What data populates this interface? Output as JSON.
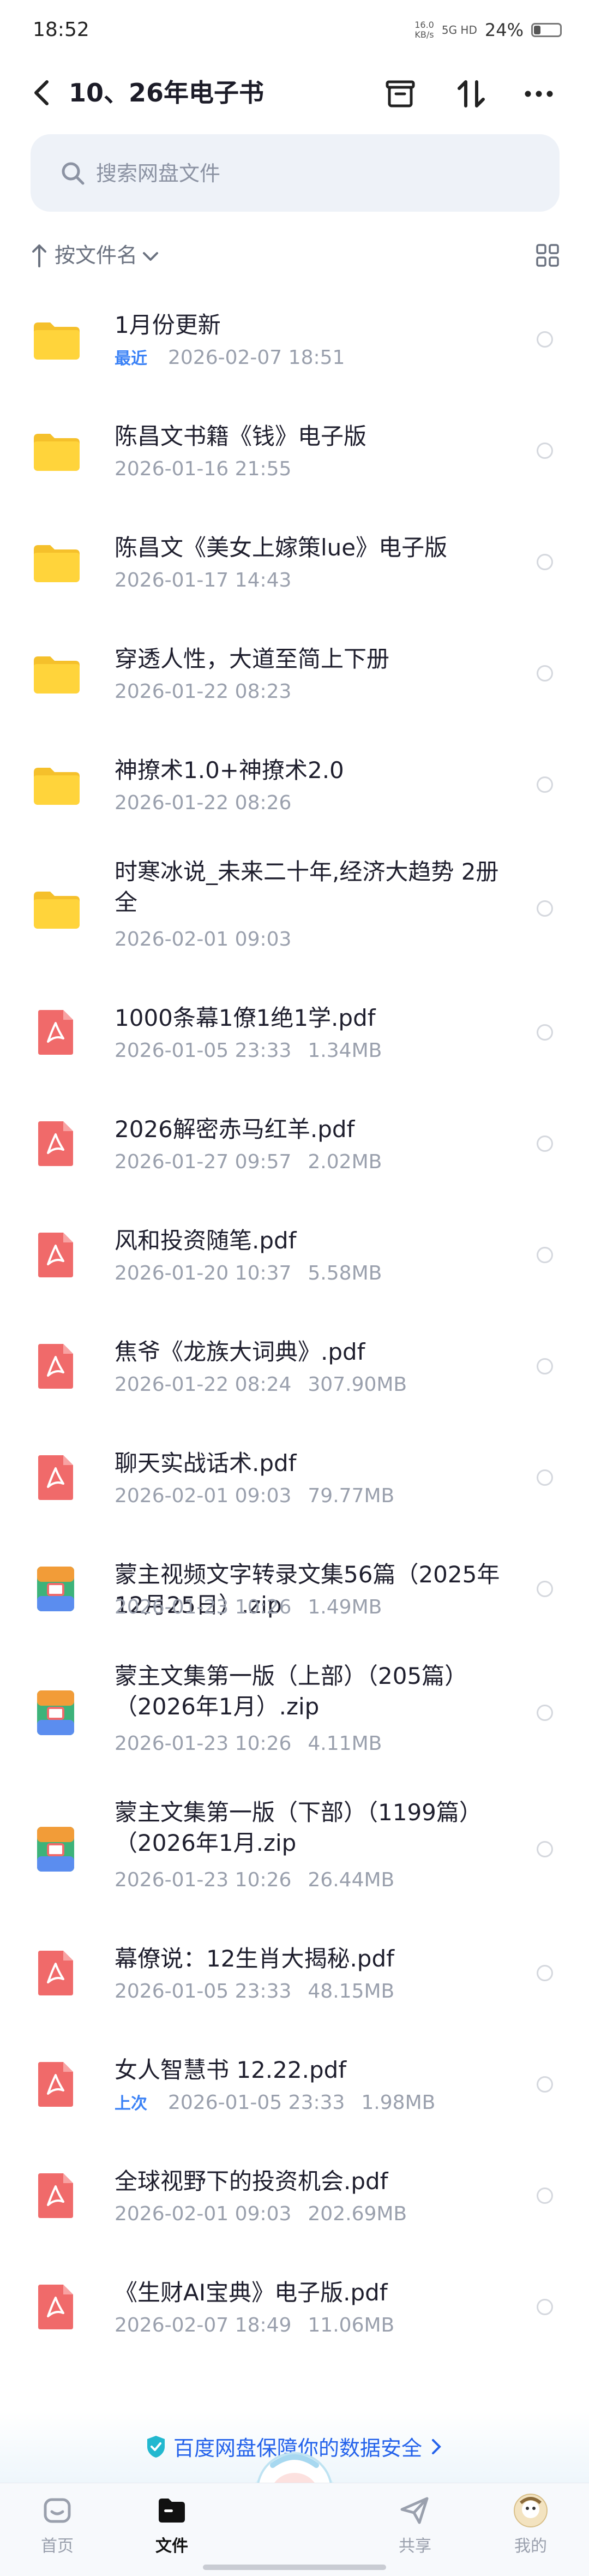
{
  "status_bar": {
    "time": "18:52",
    "net_speed_top": "16.0",
    "net_speed_bottom": "KB/s",
    "network": "5G HD",
    "battery": "24%"
  },
  "header": {
    "title": "10、26年电子书"
  },
  "search": {
    "placeholder": "搜索网盘文件"
  },
  "sort": {
    "label": "按文件名"
  },
  "files": [
    {
      "type": "folder",
      "name": "1月份更新",
      "date": "2026-02-07  18:51",
      "size": "",
      "tag": "最近"
    },
    {
      "type": "folder",
      "name": "陈昌文书籍《钱》电子版",
      "date": "2026-01-16  21:55",
      "size": "",
      "tag": ""
    },
    {
      "type": "folder",
      "name": "陈昌文《美女上嫁策lue》电子版",
      "date": "2026-01-17  14:43",
      "size": "",
      "tag": ""
    },
    {
      "type": "folder",
      "name": "穿透人性，大道至简上下册",
      "date": "2026-01-22  08:23",
      "size": "",
      "tag": ""
    },
    {
      "type": "folder",
      "name": "神撩术1.0+神撩术2.0",
      "date": "2026-01-22  08:26",
      "size": "",
      "tag": ""
    },
    {
      "type": "folder",
      "name": "时寒冰说_未来二十年,经济大趋势 2册全",
      "date": "2026-02-01  09:03",
      "size": "",
      "tag": ""
    },
    {
      "type": "pdf",
      "name": "1000条幕1僚1绝1学.pdf",
      "date": "2026-01-05  23:33",
      "size": "1.34MB",
      "tag": ""
    },
    {
      "type": "pdf",
      "name": "2026解密赤马红羊.pdf",
      "date": "2026-01-27  09:57",
      "size": "2.02MB",
      "tag": ""
    },
    {
      "type": "pdf",
      "name": "风和投资随笔.pdf",
      "date": "2026-01-20  10:37",
      "size": "5.58MB",
      "tag": ""
    },
    {
      "type": "pdf",
      "name": "焦爷《龙族大词典》.pdf",
      "date": "2026-01-22  08:24",
      "size": "307.90MB",
      "tag": ""
    },
    {
      "type": "pdf",
      "name": "聊天实战话术.pdf",
      "date": "2026-02-01  09:03",
      "size": "79.77MB",
      "tag": ""
    },
    {
      "type": "zip",
      "name": "蒙主视频文字转录文集56篇（2025年12月25日）.zip",
      "date": "2026-01-23  10:26",
      "size": "1.49MB",
      "tag": ""
    },
    {
      "type": "zip",
      "name": "蒙主文集第一版（上部）（205篇）（2026年1月）.zip",
      "date": "2026-01-23  10:26",
      "size": "4.11MB",
      "tag": ""
    },
    {
      "type": "zip",
      "name": "蒙主文集第一版（下部）（1199篇）（2026年1月.zip",
      "date": "2026-01-23  10:26",
      "size": "26.44MB",
      "tag": ""
    },
    {
      "type": "pdf",
      "name": "幕僚说：12生肖大揭秘.pdf",
      "date": "2026-01-05  23:33",
      "size": "48.15MB",
      "tag": ""
    },
    {
      "type": "pdf",
      "name": "女人智慧书 12.22.pdf",
      "date": "2026-01-05  23:33",
      "size": "1.98MB",
      "tag": "上次"
    },
    {
      "type": "pdf",
      "name": "全球视野下的投资机会.pdf",
      "date": "2026-02-01  09:03",
      "size": "202.69MB",
      "tag": ""
    },
    {
      "type": "pdf",
      "name": "《生财AI宝典》电子版.pdf",
      "date": "2026-02-07  18:49",
      "size": "11.06MB",
      "tag": ""
    }
  ],
  "security_banner": {
    "text": "百度网盘保障你的数据安全"
  },
  "nav": {
    "home": "首页",
    "files": "文件",
    "share": "共享",
    "mine": "我的"
  },
  "colors": {
    "folder": "#FFD43B",
    "pdf": "#F06A6A",
    "accent": "#2563EB"
  }
}
